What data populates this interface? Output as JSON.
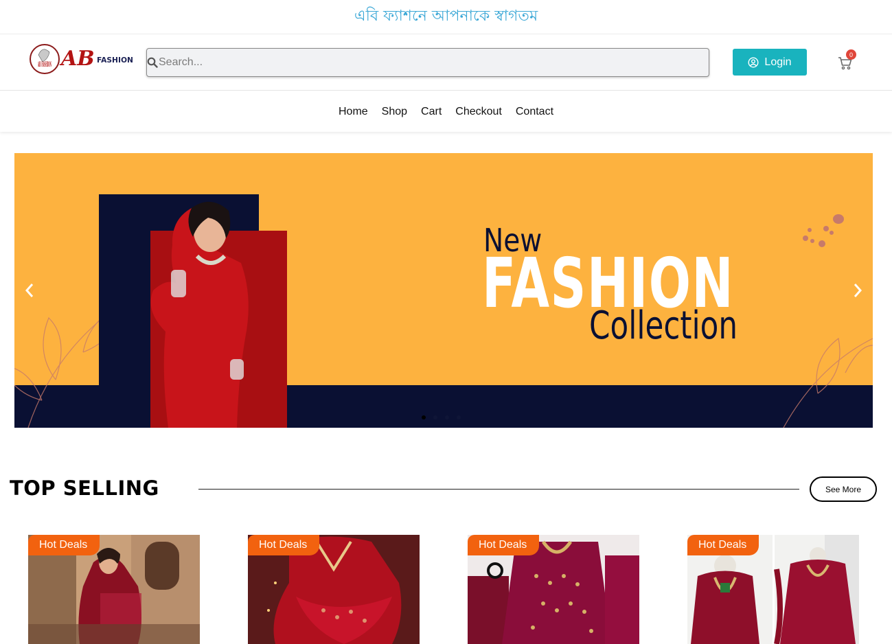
{
  "welcome": {
    "text": "এবি ফ্যাশনে আপনাকে স্বাগতম"
  },
  "header": {
    "logo_text": "AB",
    "logo_subtext": "FASHION",
    "logo_badge_text": "AB FASHION",
    "search": {
      "placeholder": "Search...",
      "value": ""
    },
    "login_label": "Login",
    "cart_count": "0"
  },
  "nav": {
    "items": [
      {
        "label": "Home"
      },
      {
        "label": "Shop"
      },
      {
        "label": "Cart"
      },
      {
        "label": "Checkout"
      },
      {
        "label": "Contact"
      }
    ]
  },
  "slider": {
    "line1": "New",
    "line2": "FASHION",
    "line3": "Collection",
    "dots": 4,
    "active_dot": 0,
    "colors": {
      "background": "#fdb23f",
      "navy": "#0a1033",
      "red": "#a80f12"
    }
  },
  "top_selling": {
    "title": "TOP SELLING",
    "see_more": "See More",
    "products": [
      {
        "badge": "Hot Deals"
      },
      {
        "badge": "Hot Deals"
      },
      {
        "badge": "Hot Deals"
      },
      {
        "badge": "Hot Deals"
      }
    ]
  },
  "colors": {
    "accent": "#19b3be",
    "badge": "#f2620f",
    "welcome_text": "#3aa7d6",
    "cart_badge": "#e0463a"
  }
}
